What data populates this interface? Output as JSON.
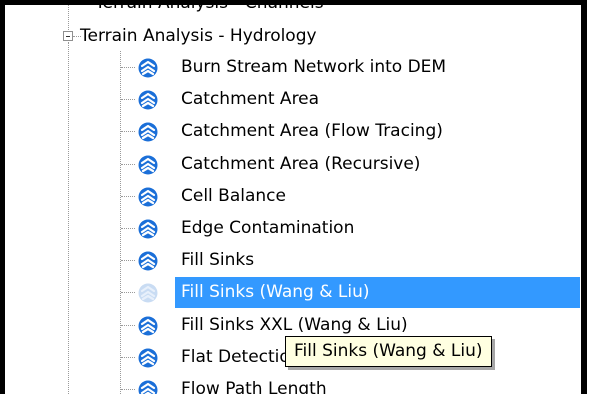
{
  "tree": {
    "partial_group_label": "Terrain Analysis - Channels",
    "group_label": "Terrain Analysis - Hydrology",
    "items": [
      {
        "label": "Burn Stream Network into DEM"
      },
      {
        "label": "Catchment Area"
      },
      {
        "label": "Catchment Area (Flow Tracing)"
      },
      {
        "label": "Catchment Area (Recursive)"
      },
      {
        "label": "Cell Balance"
      },
      {
        "label": "Edge Contamination"
      },
      {
        "label": "Fill Sinks"
      },
      {
        "label": "Fill Sinks (Wang & Liu)",
        "selected": true
      },
      {
        "label": "Fill Sinks XXL (Wang & Liu)"
      },
      {
        "label": "Flat Detection"
      },
      {
        "label": "Flow Path Length"
      }
    ],
    "tool_icon": "saga-tool-icon",
    "expander_icon": "collapse-minus-icon"
  },
  "tooltip": {
    "text": "Fill Sinks (Wang & Liu)"
  },
  "colors": {
    "selection": "#3399ff",
    "icon_blue": "#1b6fd8",
    "tooltip_bg": "#ffffe1",
    "border": "#000000"
  }
}
